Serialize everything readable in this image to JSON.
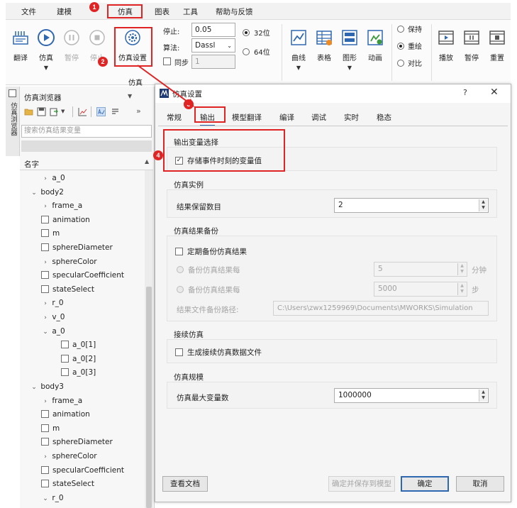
{
  "menubar": {
    "items": [
      "文件",
      "建模",
      "仿真",
      "图表",
      "工具",
      "帮助与反馈"
    ]
  },
  "ribbon": {
    "buttons": {
      "translate": "翻译",
      "simulate": "仿真",
      "pause": "暂停",
      "stop": "停止",
      "sim_settings": "仿真设置",
      "curve": "曲线",
      "table": "表格",
      "graphic": "图形",
      "animation": "动画",
      "play": "播放",
      "anim_pause": "暂停",
      "replay": "重置"
    },
    "params": {
      "stop_label": "停止:",
      "stop_value": "0.05",
      "algo_label": "算法:",
      "algo_value": "Dassl",
      "sync_label": "同步",
      "sync_value": "1"
    },
    "bits": {
      "b32": "32位",
      "b64": "64位"
    },
    "modes": {
      "keep": "保持",
      "overlay": "重绘",
      "compare": "对比"
    },
    "group_label": "仿真"
  },
  "side_tab": {
    "label": "仿真浏览器"
  },
  "browser": {
    "title": "仿真浏览器",
    "search_placeholder": "搜索仿真结果变量",
    "column_header": "名字",
    "tree": [
      {
        "label": "a_0",
        "kind": "expand",
        "level": 2
      },
      {
        "label": "body2",
        "kind": "open",
        "level": 1
      },
      {
        "label": "frame_a",
        "kind": "expand",
        "level": 2
      },
      {
        "label": "animation",
        "kind": "check",
        "level": 2
      },
      {
        "label": "m",
        "kind": "check",
        "level": 2
      },
      {
        "label": "sphereDiameter",
        "kind": "check",
        "level": 2
      },
      {
        "label": "sphereColor",
        "kind": "expand",
        "level": 2
      },
      {
        "label": "specularCoefficient",
        "kind": "check",
        "level": 2
      },
      {
        "label": "stateSelect",
        "kind": "check",
        "level": 2
      },
      {
        "label": "r_0",
        "kind": "expand",
        "level": 2
      },
      {
        "label": "v_0",
        "kind": "expand",
        "level": 2
      },
      {
        "label": "a_0",
        "kind": "open",
        "level": 2
      },
      {
        "label": "a_0[1]",
        "kind": "check",
        "level": 3
      },
      {
        "label": "a_0[2]",
        "kind": "check",
        "level": 3
      },
      {
        "label": "a_0[3]",
        "kind": "check",
        "level": 3
      },
      {
        "label": "body3",
        "kind": "open",
        "level": 1
      },
      {
        "label": "frame_a",
        "kind": "expand",
        "level": 2
      },
      {
        "label": "animation",
        "kind": "check",
        "level": 2
      },
      {
        "label": "m",
        "kind": "check",
        "level": 2
      },
      {
        "label": "sphereDiameter",
        "kind": "check",
        "level": 2
      },
      {
        "label": "sphereColor",
        "kind": "expand",
        "level": 2
      },
      {
        "label": "specularCoefficient",
        "kind": "check",
        "level": 2
      },
      {
        "label": "stateSelect",
        "kind": "check",
        "level": 2
      },
      {
        "label": "r_0",
        "kind": "open",
        "level": 2
      }
    ]
  },
  "dialog": {
    "title": "仿真设置",
    "help": "?",
    "close": "✕",
    "tabs": [
      "常规",
      "输出",
      "模型翻译",
      "编译",
      "调试",
      "实时",
      "稳态"
    ],
    "output_vars": {
      "title": "输出变量选择",
      "store_events_label": "存储事件时刻的变量值",
      "store_events_checked": true
    },
    "instance": {
      "title": "仿真实例",
      "keep_count_label": "结果保留数目",
      "keep_count_value": "2"
    },
    "backup": {
      "title": "仿真结果备份",
      "periodic_label": "定期备份仿真结果",
      "every_label": "备份仿真结果每",
      "every_minutes_value": "5",
      "minutes_unit": "分钟",
      "every_steps_value": "5000",
      "steps_unit": "步",
      "path_label": "结果文件备份路径:",
      "path_value": "C:\\Users\\zwx1259969\\Documents\\MWORKS\\Simulation"
    },
    "continue": {
      "title": "接续仿真",
      "gen_file_label": "生成接续仿真数据文件"
    },
    "scale": {
      "title": "仿真规模",
      "max_vars_label": "仿真最大变量数",
      "max_vars_value": "1000000"
    },
    "buttons": {
      "view_doc": "查看文档",
      "ok_save": "确定并保存到模型",
      "ok": "确定",
      "cancel": "取消"
    }
  },
  "annotations": {
    "badges": [
      "1",
      "2",
      "3",
      "4"
    ],
    "color": "#e02424"
  }
}
